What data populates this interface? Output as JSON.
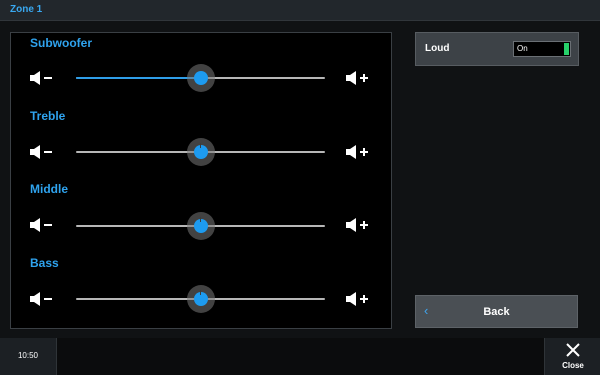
{
  "header": {
    "title": "Zone 1"
  },
  "equalizer": {
    "sliders": [
      {
        "label": "Subwoofer",
        "value_percent": 50,
        "active": true
      },
      {
        "label": "Treble",
        "value_percent": 50,
        "active": false
      },
      {
        "label": "Middle",
        "value_percent": 50,
        "active": false
      },
      {
        "label": "Bass",
        "value_percent": 50,
        "active": false
      }
    ],
    "icons": {
      "decrease": "volume-down-icon",
      "increase": "volume-up-icon"
    }
  },
  "loudness": {
    "label": "Loud",
    "toggle_text": "On",
    "toggle_on": true,
    "on_color": "#27d06a"
  },
  "back_button": {
    "label": "Back",
    "icon": "chevron-left-icon"
  },
  "footer": {
    "clock": "10:50",
    "close_label": "Close",
    "close_icon": "close-icon"
  },
  "colors": {
    "accent": "#2fa3ee",
    "thumb": "#1d9bf0"
  }
}
